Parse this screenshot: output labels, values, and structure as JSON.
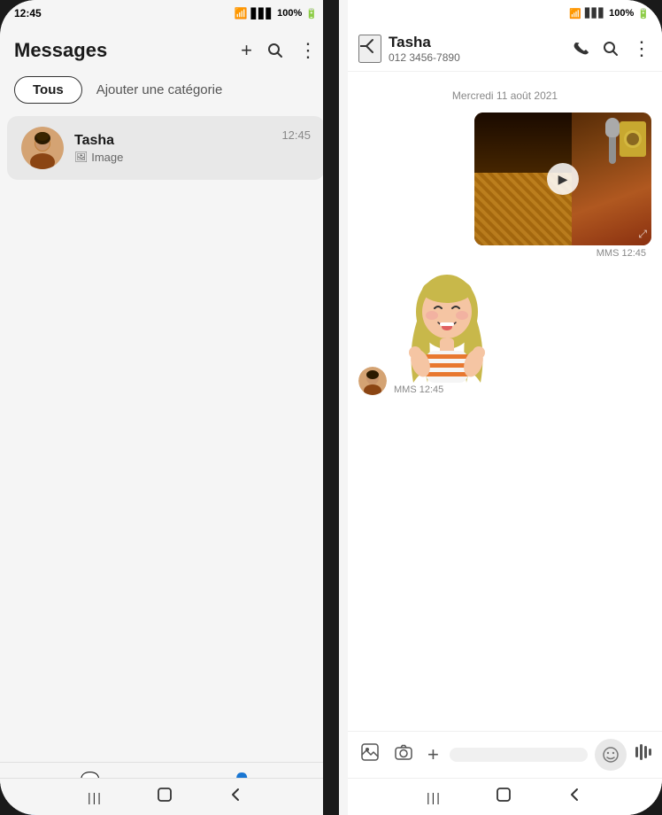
{
  "statusBar": {
    "time": "12:45",
    "battery": "100%",
    "batteryIcon": "🔋"
  },
  "leftPanel": {
    "title": "Messages",
    "addIcon": "+",
    "searchIcon": "🔍",
    "moreIcon": "⋮",
    "categories": {
      "activeLabel": "Tous",
      "addLabel": "Ajouter une catégorie"
    },
    "conversations": [
      {
        "name": "Tasha",
        "preview": "Image",
        "time": "12:45",
        "hasImageIcon": true
      }
    ],
    "bottomNav": [
      {
        "label": "Conversations",
        "active": true
      },
      {
        "label": "Contacts",
        "active": false
      }
    ]
  },
  "rightPanel": {
    "backIcon": "←",
    "contactName": "Tasha",
    "contactPhone": "012 3456-7890",
    "callIcon": "📞",
    "searchIcon": "🔍",
    "moreIcon": "⋮",
    "messages": [
      {
        "type": "date",
        "label": "Mercredi 11 août 2021"
      },
      {
        "type": "outgoing-media",
        "mediaType": "video",
        "meta": "MMS  12:45"
      },
      {
        "type": "incoming-sticker",
        "meta": "MMS  12:45"
      }
    ],
    "inputArea": {
      "galleryIcon": "🖼",
      "cameraIcon": "📷",
      "addIcon": "+",
      "placeholder": "",
      "stickerIcon": "😊",
      "voiceIcon": "📊"
    }
  },
  "systemNav": {
    "menuIcon": "|||",
    "homeIcon": "○",
    "backIcon": "<"
  }
}
